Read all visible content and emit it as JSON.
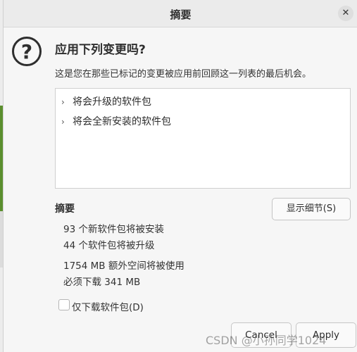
{
  "dialog": {
    "title": "摘要",
    "close_glyph": "✕",
    "heading": "应用下列变更吗?",
    "description": "这是您在那些已标记的变更被应用前回顾这一列表的最后机会。",
    "list": [
      {
        "label": "将会升级的软件包"
      },
      {
        "label": "将会全新安装的软件包"
      }
    ],
    "summary_title": "摘要",
    "details_button": "显示细节(S)",
    "summary_lines": [
      "93 个新软件包将被安装",
      "44 个软件包将被升级",
      "1754 MB 额外空间将被使用",
      "必须下载 341 MB"
    ],
    "download_only_label": "仅下载软件包(D)",
    "cancel_button": "Cancel",
    "apply_button": "Apply"
  },
  "watermark": "CSDN @小孙同学1024",
  "icons": {
    "question": "?",
    "chevron": "›"
  }
}
